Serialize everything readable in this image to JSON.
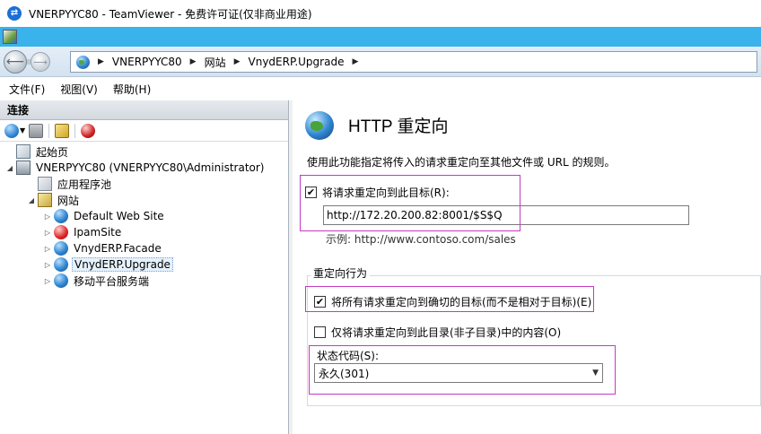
{
  "window": {
    "title": "VNERPYYC80 - TeamViewer - 免费许可证(仅非商业用途)"
  },
  "address": {
    "crumbs": [
      "VNERPYYC80",
      "网站",
      "VnydERP.Upgrade"
    ]
  },
  "menu": {
    "items": [
      "文件(F)",
      "视图(V)",
      "帮助(H)"
    ]
  },
  "connections": {
    "header": "连接",
    "tree": {
      "start_page": "起始页",
      "server": "VNERPYYC80 (VNERPYYC80\\Administrator)",
      "app_pools": "应用程序池",
      "sites": "网站",
      "site_items": [
        "Default Web Site",
        "IpamSite",
        "VnydERP.Facade",
        "VnydERP.Upgrade",
        "移动平台服务端"
      ]
    }
  },
  "feature": {
    "title": "HTTP 重定向",
    "description": "使用此功能指定将传入的请求重定向至其他文件或 URL 的规则。",
    "redirect_checkbox_label": "将请求重定向到此目标(R):",
    "redirect_checked": true,
    "target_url": "http://172.20.200.82:8001/$S$Q",
    "example": "示例: http://www.contoso.com/sales",
    "group_label": "重定向行为",
    "exact_dest_label": "将所有请求重定向到确切的目标(而不是相对于目标)(E)",
    "exact_dest_checked": true,
    "only_this_dir_label": "仅将请求重定向到此目录(非子目录)中的内容(O)",
    "only_this_dir_checked": false,
    "status_code_label": "状态代码(S):",
    "status_code_value": "永久(301)"
  },
  "colors": {
    "highlight": "#c43ac4",
    "cyan_bar": "#3ab2ec",
    "accent": "#1a6fd6"
  }
}
